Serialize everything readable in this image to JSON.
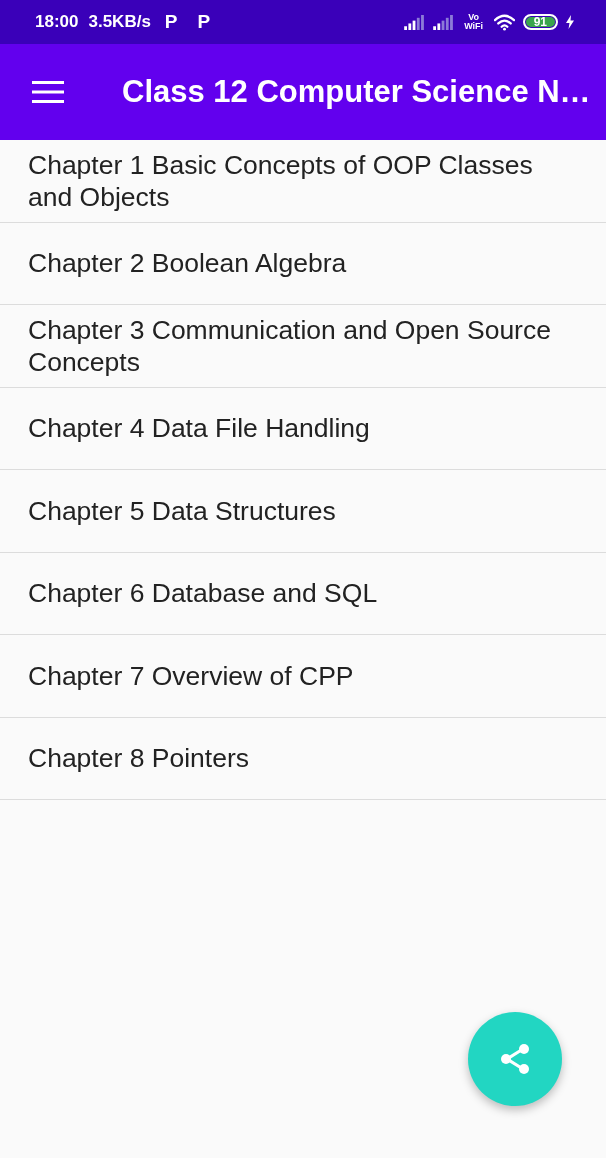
{
  "status_bar": {
    "time": "18:00",
    "net_speed": "3.5KB/s",
    "notification_icons": [
      "P",
      "P"
    ],
    "vowifi_label": "Vo WiFi",
    "battery_text": "91",
    "charging": true
  },
  "app_bar": {
    "title": "Class 12 Computer Science N…"
  },
  "chapters": [
    "Chapter 1 Basic Concepts of OOP Classes and Objects",
    "Chapter 2 Boolean Algebra",
    "Chapter 3 Communication and Open Source Concepts",
    "Chapter 4 Data File Handling",
    "Chapter 5 Data Structures",
    "Chapter 6 Database and SQL",
    "Chapter 7 Overview of CPP",
    "Chapter 8 Pointers"
  ]
}
